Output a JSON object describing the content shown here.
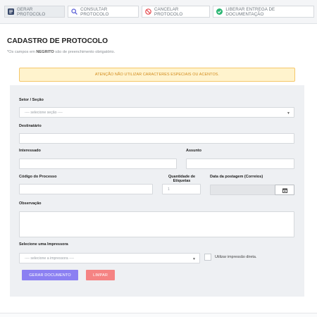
{
  "tabs": [
    {
      "label": "GERAR PROTOCOLO",
      "icon": "document-icon",
      "color": "#3a4a6b"
    },
    {
      "label": "CONSULTAR PROTOCOLO",
      "icon": "search-icon",
      "color": "#5a5fd6"
    },
    {
      "label": "CANCELAR PROTOCOLO",
      "icon": "cancel-icon",
      "color": "#e5484d"
    },
    {
      "label": "LIBERAR ENTREGA DE DOCUMENTAÇÃO",
      "icon": "check-circle-icon",
      "color": "#2bb673"
    }
  ],
  "page": {
    "title": "CADASTRO DE PROTOCOLO",
    "note_prefix": "*Os campos em ",
    "note_bold": "NEGRITO",
    "note_suffix": " são de preenchimento obrigatório."
  },
  "warning": "ATENÇÃO NÃO UTILIZAR CARACTERES ESPECIAIS OU ACENTOS.",
  "form": {
    "setor_label": "Setor / Seção",
    "setor_placeholder": "---- selecione seção ----",
    "destinatario_label": "Destinatário",
    "interessado_label": "Interessado",
    "assunto_label": "Assunto",
    "codigo_label": "Código do Processo",
    "qtd_label_line1": "Quantidade de",
    "qtd_label_line2": "Etiquetas",
    "qtd_value": "1",
    "data_label": "Data da postagem (Correios)",
    "observacao_label": "Observação",
    "impressora_label": "Selecione uma Impressora",
    "impressora_placeholder": "---- selecione a impressora ----",
    "impressao_direta_label": "Utilizar impressão direta.",
    "gerar_button": "GERAR DOCUMENTO",
    "limpar_button": "LIMPAR"
  }
}
